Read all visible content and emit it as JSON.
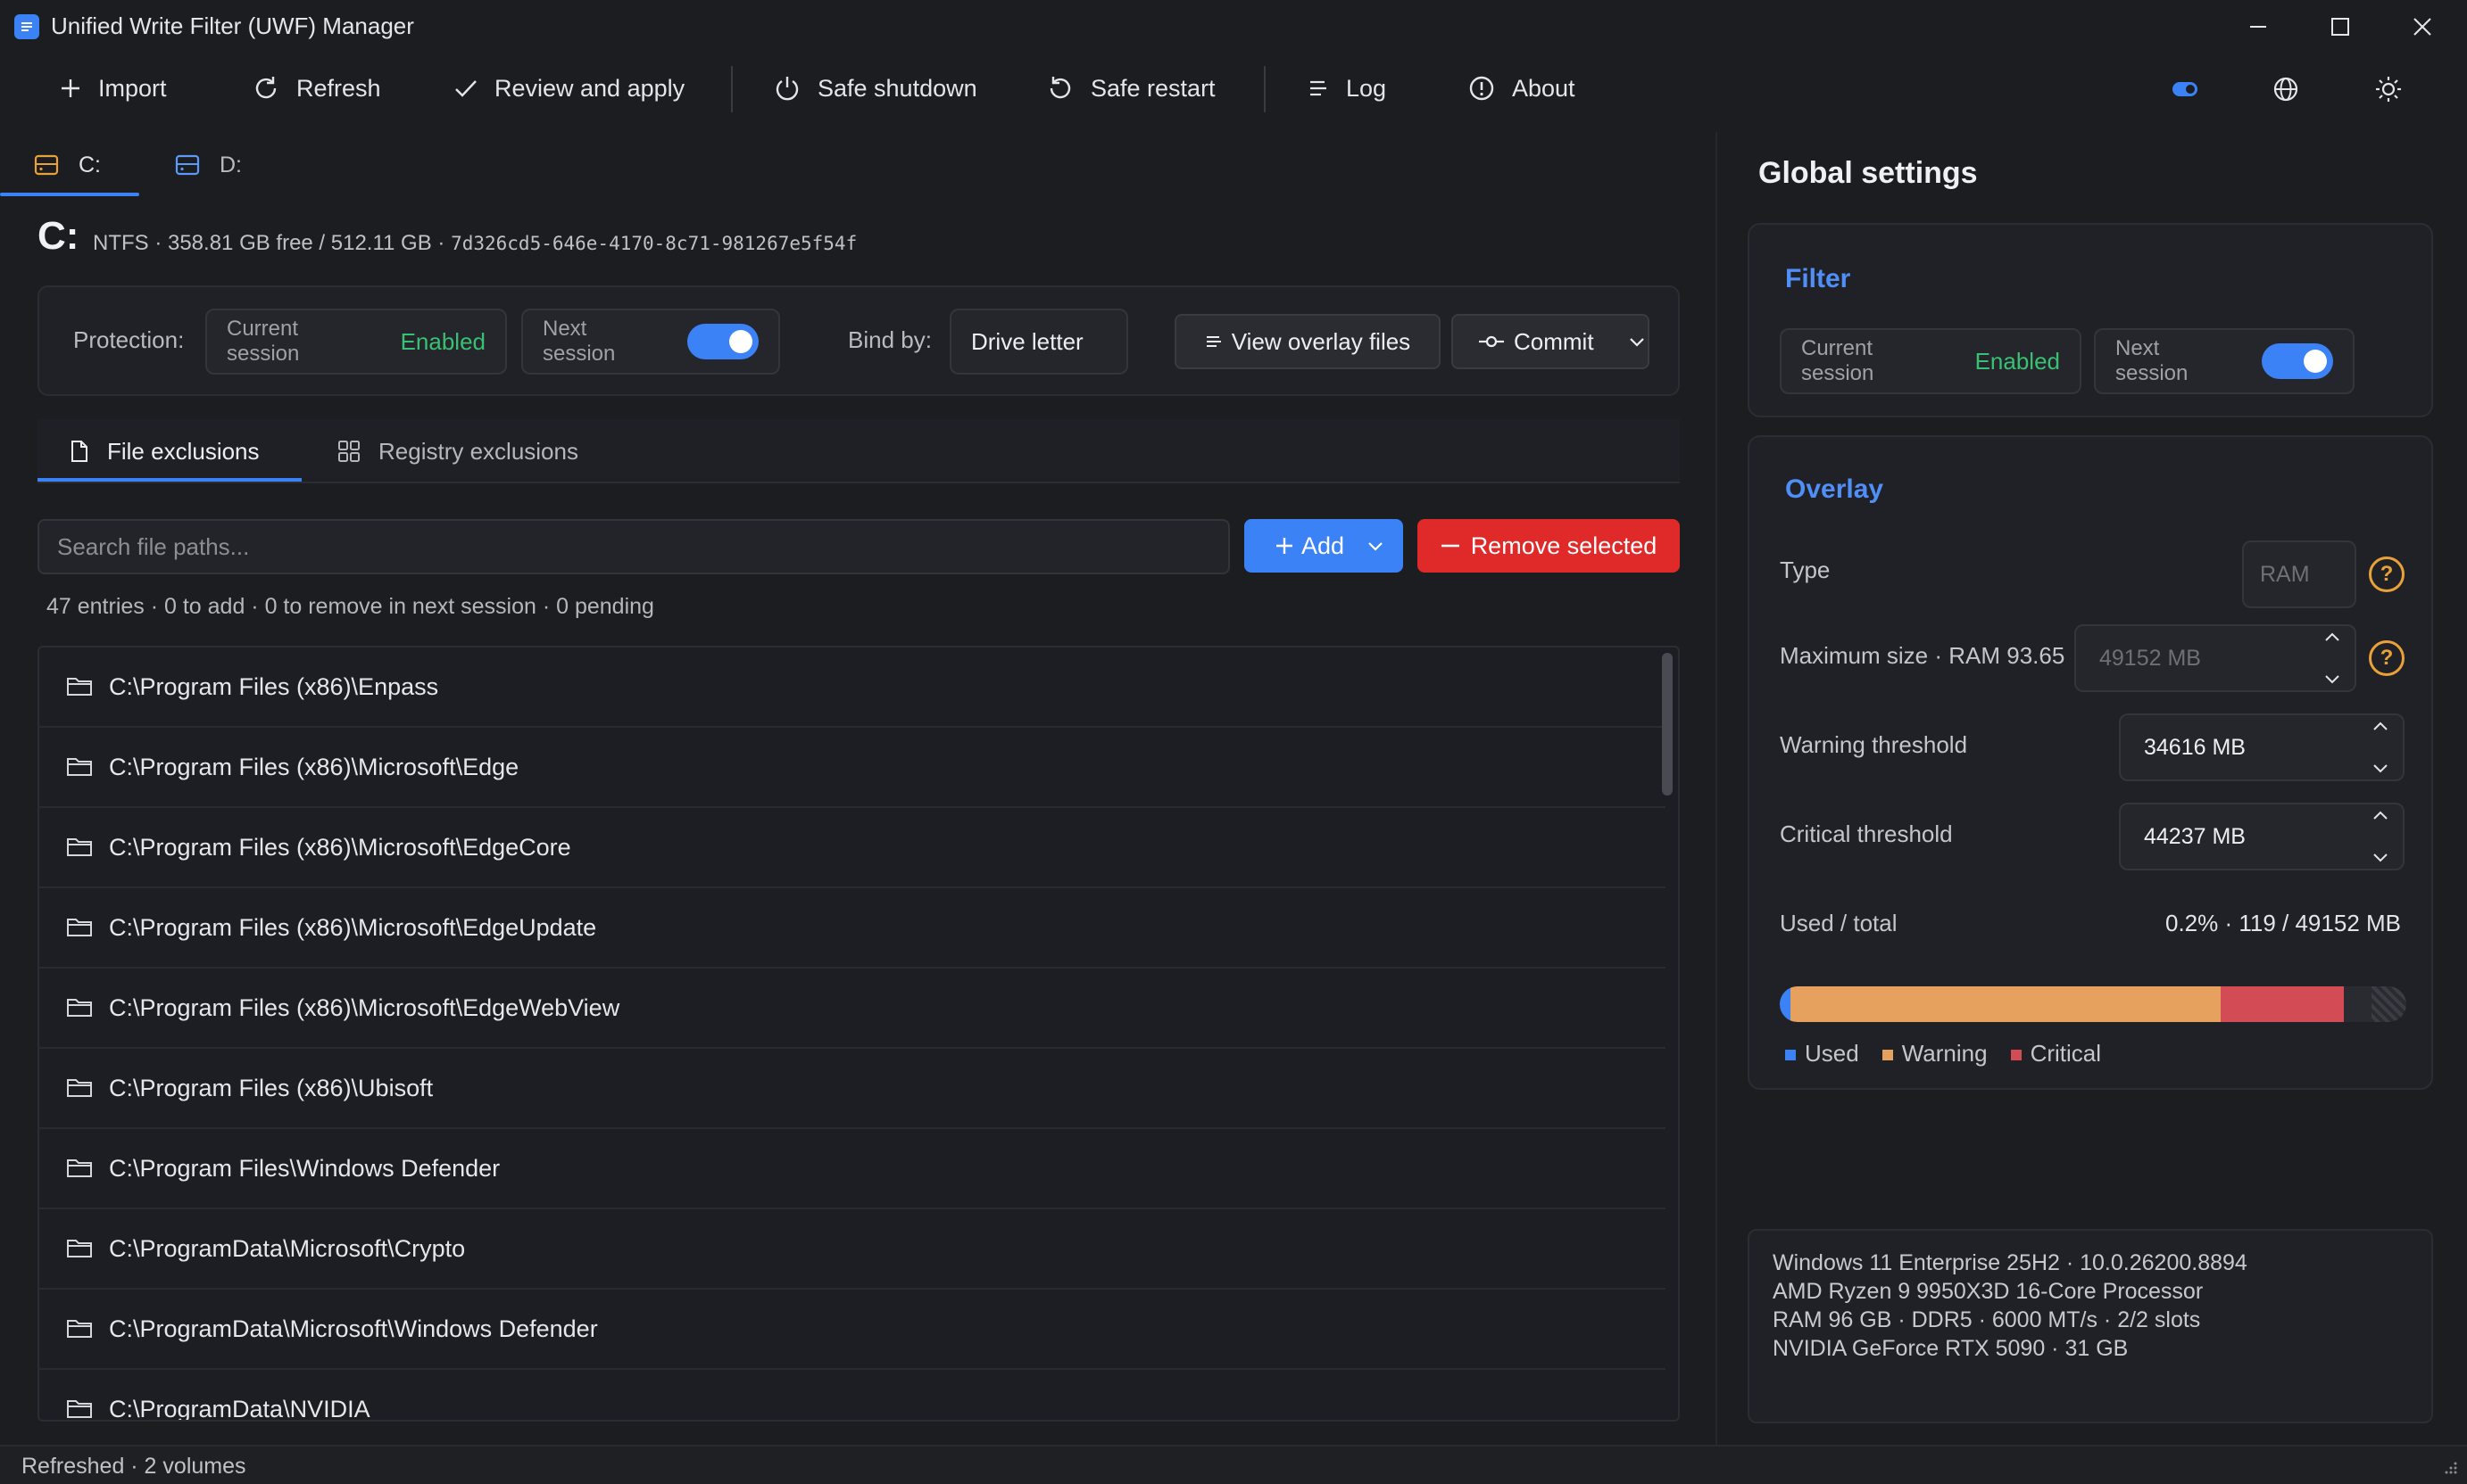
{
  "window": {
    "title": "Unified Write Filter (UWF) Manager"
  },
  "toolbar": {
    "import": "Import",
    "refresh": "Refresh",
    "review": "Review and apply",
    "shutdown": "Safe shutdown",
    "restart": "Safe restart",
    "log": "Log",
    "about": "About"
  },
  "drives": [
    {
      "label": "C:",
      "selected": true
    },
    {
      "label": "D:",
      "selected": false
    }
  ],
  "drive": {
    "letter": "C:",
    "info": "NTFS · 358.81 GB free / 512.11 GB · ",
    "guid": "7d326cd5-646e-4170-8c71-981267e5f54f"
  },
  "protection": {
    "label": "Protection:",
    "current_label": "Current session",
    "current_value": "Enabled",
    "next_label": "Next session",
    "next_enabled": true,
    "bind_label": "Bind by:",
    "bind_value": "Drive letter",
    "view_overlay": "View overlay files",
    "commit": "Commit"
  },
  "tabs": {
    "file_exclusions": "File exclusions",
    "registry_exclusions": "Registry exclusions"
  },
  "search": {
    "placeholder": "Search file paths..."
  },
  "actions": {
    "add": "Add",
    "remove": "Remove selected"
  },
  "summary": "47 entries · 0 to add · 0 to remove in next session · 0 pending",
  "files": [
    "C:\\Program Files (x86)\\Enpass",
    "C:\\Program Files (x86)\\Microsoft\\Edge",
    "C:\\Program Files (x86)\\Microsoft\\EdgeCore",
    "C:\\Program Files (x86)\\Microsoft\\EdgeUpdate",
    "C:\\Program Files (x86)\\Microsoft\\EdgeWebView",
    "C:\\Program Files (x86)\\Ubisoft",
    "C:\\Program Files\\Windows Defender",
    "C:\\ProgramData\\Microsoft\\Crypto",
    "C:\\ProgramData\\Microsoft\\Windows Defender",
    "C:\\ProgramData\\NVIDIA"
  ],
  "global": {
    "title": "Global settings",
    "filter": {
      "title": "Filter",
      "current_label": "Current session",
      "current_value": "Enabled",
      "next_label": "Next session",
      "next_enabled": true
    },
    "overlay": {
      "title": "Overlay",
      "type_label": "Type",
      "type_value": "RAM",
      "max_label": "Maximum size · RAM 93.65",
      "max_value": "49152 MB",
      "warn_label": "Warning threshold",
      "warn_value": "34616 MB",
      "crit_label": "Critical threshold",
      "crit_value": "44237 MB",
      "used_label": "Used / total",
      "used_value": "0.2% · 119 / 49152 MB",
      "used_mb": 119,
      "warning_mb": 34616,
      "critical_mb": 44237,
      "total_mb": 49152,
      "legend_used": "Used",
      "legend_warning": "Warning",
      "legend_critical": "Critical",
      "help": "?"
    }
  },
  "sysinfo": [
    "Windows 11 Enterprise 25H2 · 10.0.26200.8894",
    "AMD Ryzen 9 9950X3D 16-Core Processor",
    "RAM 96 GB · DDR5 · 6000 MT/s · 2/2 slots",
    "NVIDIA GeForce RTX 5090 · 31 GB"
  ],
  "status": "Refreshed · 2 volumes",
  "colors": {
    "accent": "#3b82f6",
    "enabled": "#38c172",
    "danger": "#e02a2a",
    "warning": "#e6a15f",
    "critical": "#d24b55"
  }
}
